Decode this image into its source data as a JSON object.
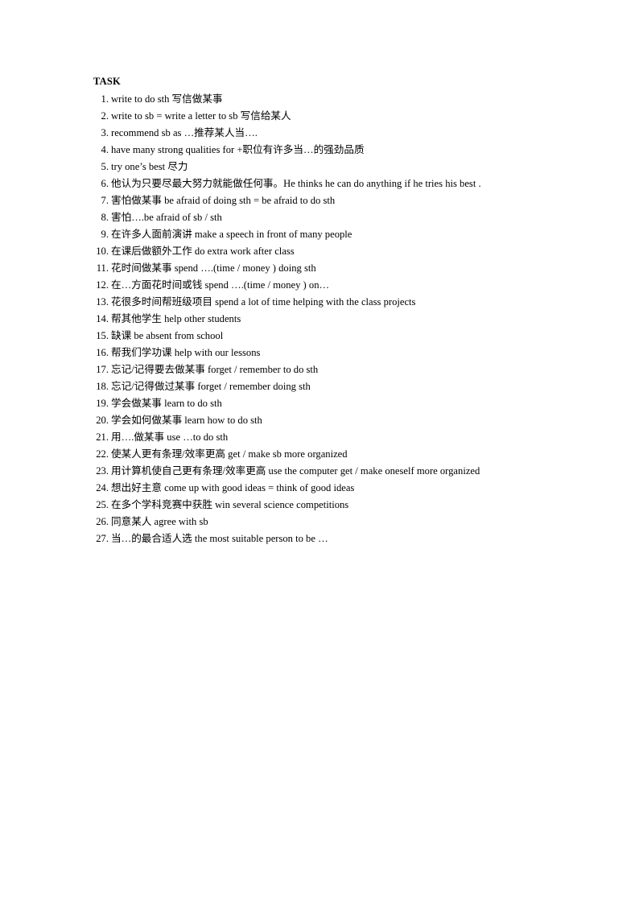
{
  "document": {
    "title": "TASK",
    "items": [
      {
        "number": "1.",
        "text": "write to do sth  写信做某事"
      },
      {
        "number": "2.",
        "text": "write to sb = write a letter to sb  写信给某人"
      },
      {
        "number": "3.",
        "text": "recommend sb as …推荐某人当…."
      },
      {
        "number": "4.",
        "text": "have many strong qualities for +职位有许多当…的强劲品质"
      },
      {
        "number": "5.",
        "text": "try one’s best  尽力"
      },
      {
        "number": "6.",
        "text": "他认为只要尽最大努力就能做任何事。He thinks he can do anything if he tries his best ."
      },
      {
        "number": "7.",
        "text": "害怕做某事 be afraid of doing sth = be afraid to do sth"
      },
      {
        "number": "8.",
        "text": "害怕….be afraid of sb / sth"
      },
      {
        "number": "9.",
        "text": "在许多人面前演讲 make a speech in front of many people"
      },
      {
        "number": "10.",
        "text": "在课后做额外工作 do extra work after class"
      },
      {
        "number": "11.",
        "text": "花时间做某事 spend ….(time / money ) doing sth"
      },
      {
        "number": "12.",
        "text": "在…方面花时间或钱 spend ….(time / money ) on…"
      },
      {
        "number": "13.",
        "text": "花很多时间帮班级项目 spend a lot of time helping with the class projects"
      },
      {
        "number": "14.",
        "text": "帮其他学生 help other students"
      },
      {
        "number": "15.",
        "text": "缺课 be absent from school"
      },
      {
        "number": "16.",
        "text": "帮我们学功课 help with our lessons"
      },
      {
        "number": "17.",
        "text": "忘记/记得要去做某事 forget / remember to do sth"
      },
      {
        "number": "18.",
        "text": "忘记/记得做过某事 forget / remember doing sth"
      },
      {
        "number": "19.",
        "text": "学会做某事 learn to do sth"
      },
      {
        "number": "20.",
        "text": "学会如何做某事 learn how to do sth"
      },
      {
        "number": "21.",
        "text": "用….做某事 use …to do sth"
      },
      {
        "number": "22.",
        "text": "使某人更有条理/效率更高 get / make sb more organized"
      },
      {
        "number": "23.",
        "text": "用计算机使自己更有条理/效率更高 use the computer get / make oneself more organized"
      },
      {
        "number": "24.",
        "text": "想出好主意 come up with good ideas = think of good ideas"
      },
      {
        "number": "25.",
        "text": "在多个学科竞赛中获胜 win several science competitions"
      },
      {
        "number": "26.",
        "text": "同意某人 agree with sb"
      },
      {
        "number": "27.",
        "text": "当…的最合适人选 the most suitable person to be …"
      }
    ]
  }
}
